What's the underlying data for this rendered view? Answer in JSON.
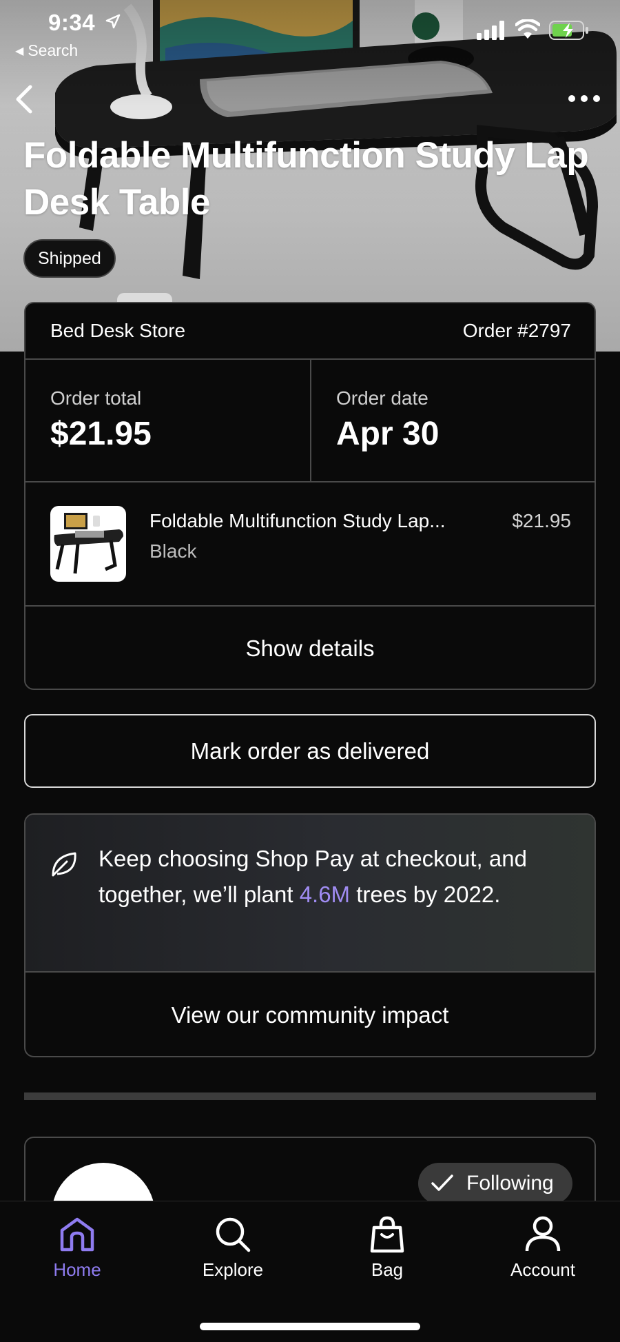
{
  "status_bar": {
    "time": "9:34",
    "back_label": "Search"
  },
  "product": {
    "title": "Foldable Multifunction Study Lap Desk Table",
    "status": "Shipped"
  },
  "order": {
    "store": "Bed Desk Store",
    "number": "Order #2797",
    "total_label": "Order total",
    "total": "$21.95",
    "date_label": "Order date",
    "date": "Apr 30",
    "item": {
      "name": "Foldable Multifunction Study Lap...",
      "variant": "Black",
      "price": "$21.95"
    },
    "show_details": "Show details"
  },
  "mark_delivered": "Mark order as delivered",
  "impact": {
    "text_before": "Keep choosing Shop Pay at checkout, and together, we’ll plant ",
    "highlight": "4.6M",
    "text_after": " trees by 2022.",
    "link": "View our community impact"
  },
  "store_card": {
    "follow_label": "Following"
  },
  "tabs": [
    {
      "label": "Home",
      "icon": "home-icon",
      "active": true
    },
    {
      "label": "Explore",
      "icon": "search-icon",
      "active": false
    },
    {
      "label": "Bag",
      "icon": "bag-icon",
      "active": false
    },
    {
      "label": "Account",
      "icon": "account-icon",
      "active": false
    }
  ],
  "colors": {
    "accent": "#8f7cf0",
    "highlight": "#a08cf2",
    "background": "#0a0a0a",
    "border": "#4a4a4a"
  }
}
